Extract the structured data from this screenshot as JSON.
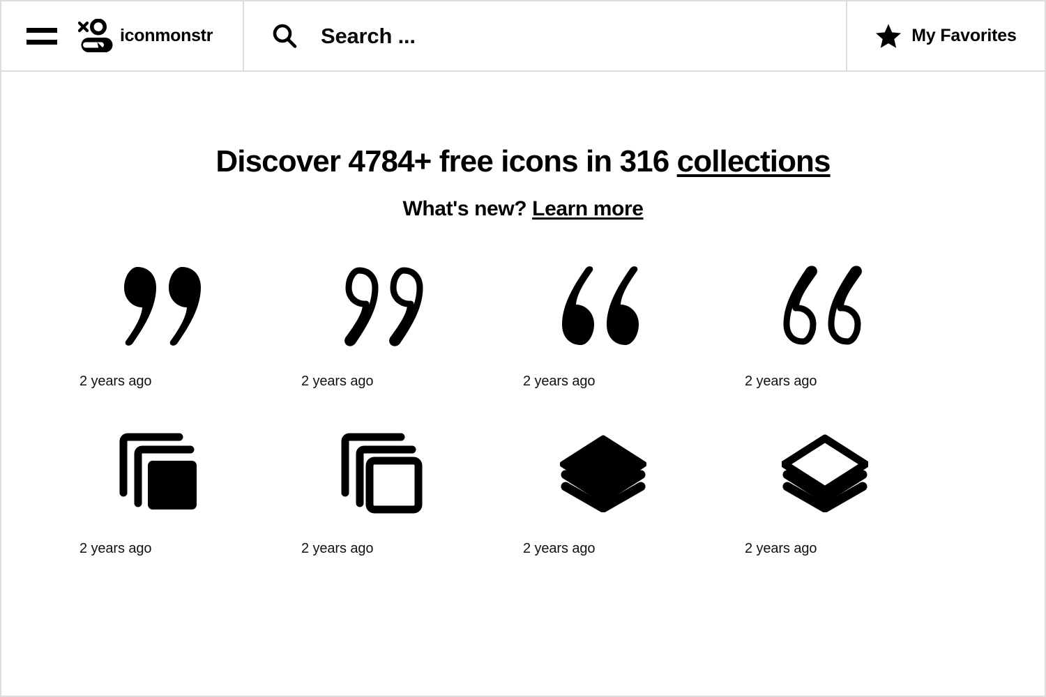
{
  "header": {
    "menu_icon": "hamburger-icon",
    "brand_icon": "iconmonstr-monster-logo",
    "brand_name": "iconmonstr",
    "search": {
      "icon": "search-icon",
      "placeholder": "Search ...",
      "value": ""
    },
    "favorites": {
      "icon": "star-icon",
      "label": "My Favorites"
    }
  },
  "hero": {
    "title_pre": "Discover 4784+ free icons in 316 ",
    "title_link": "collections",
    "icon_count": "4784+",
    "collection_count": "316",
    "subtitle_pre": "What's new? ",
    "subtitle_link": "Learn more"
  },
  "grid": {
    "items": [
      {
        "name": "quote-right-filled-icon",
        "caption": "2 years ago"
      },
      {
        "name": "quote-right-outline-icon",
        "caption": "2 years ago"
      },
      {
        "name": "quote-left-filled-icon",
        "caption": "2 years ago"
      },
      {
        "name": "quote-left-outline-icon",
        "caption": "2 years ago"
      },
      {
        "name": "copy-squares-filled-icon",
        "caption": "2 years ago"
      },
      {
        "name": "copy-squares-outline-icon",
        "caption": "2 years ago"
      },
      {
        "name": "layers-filled-icon",
        "caption": "2 years ago"
      },
      {
        "name": "layers-outline-icon",
        "caption": "2 years ago"
      }
    ]
  },
  "colors": {
    "ink": "#000000",
    "border": "#dcdcdc",
    "background": "#ffffff"
  }
}
